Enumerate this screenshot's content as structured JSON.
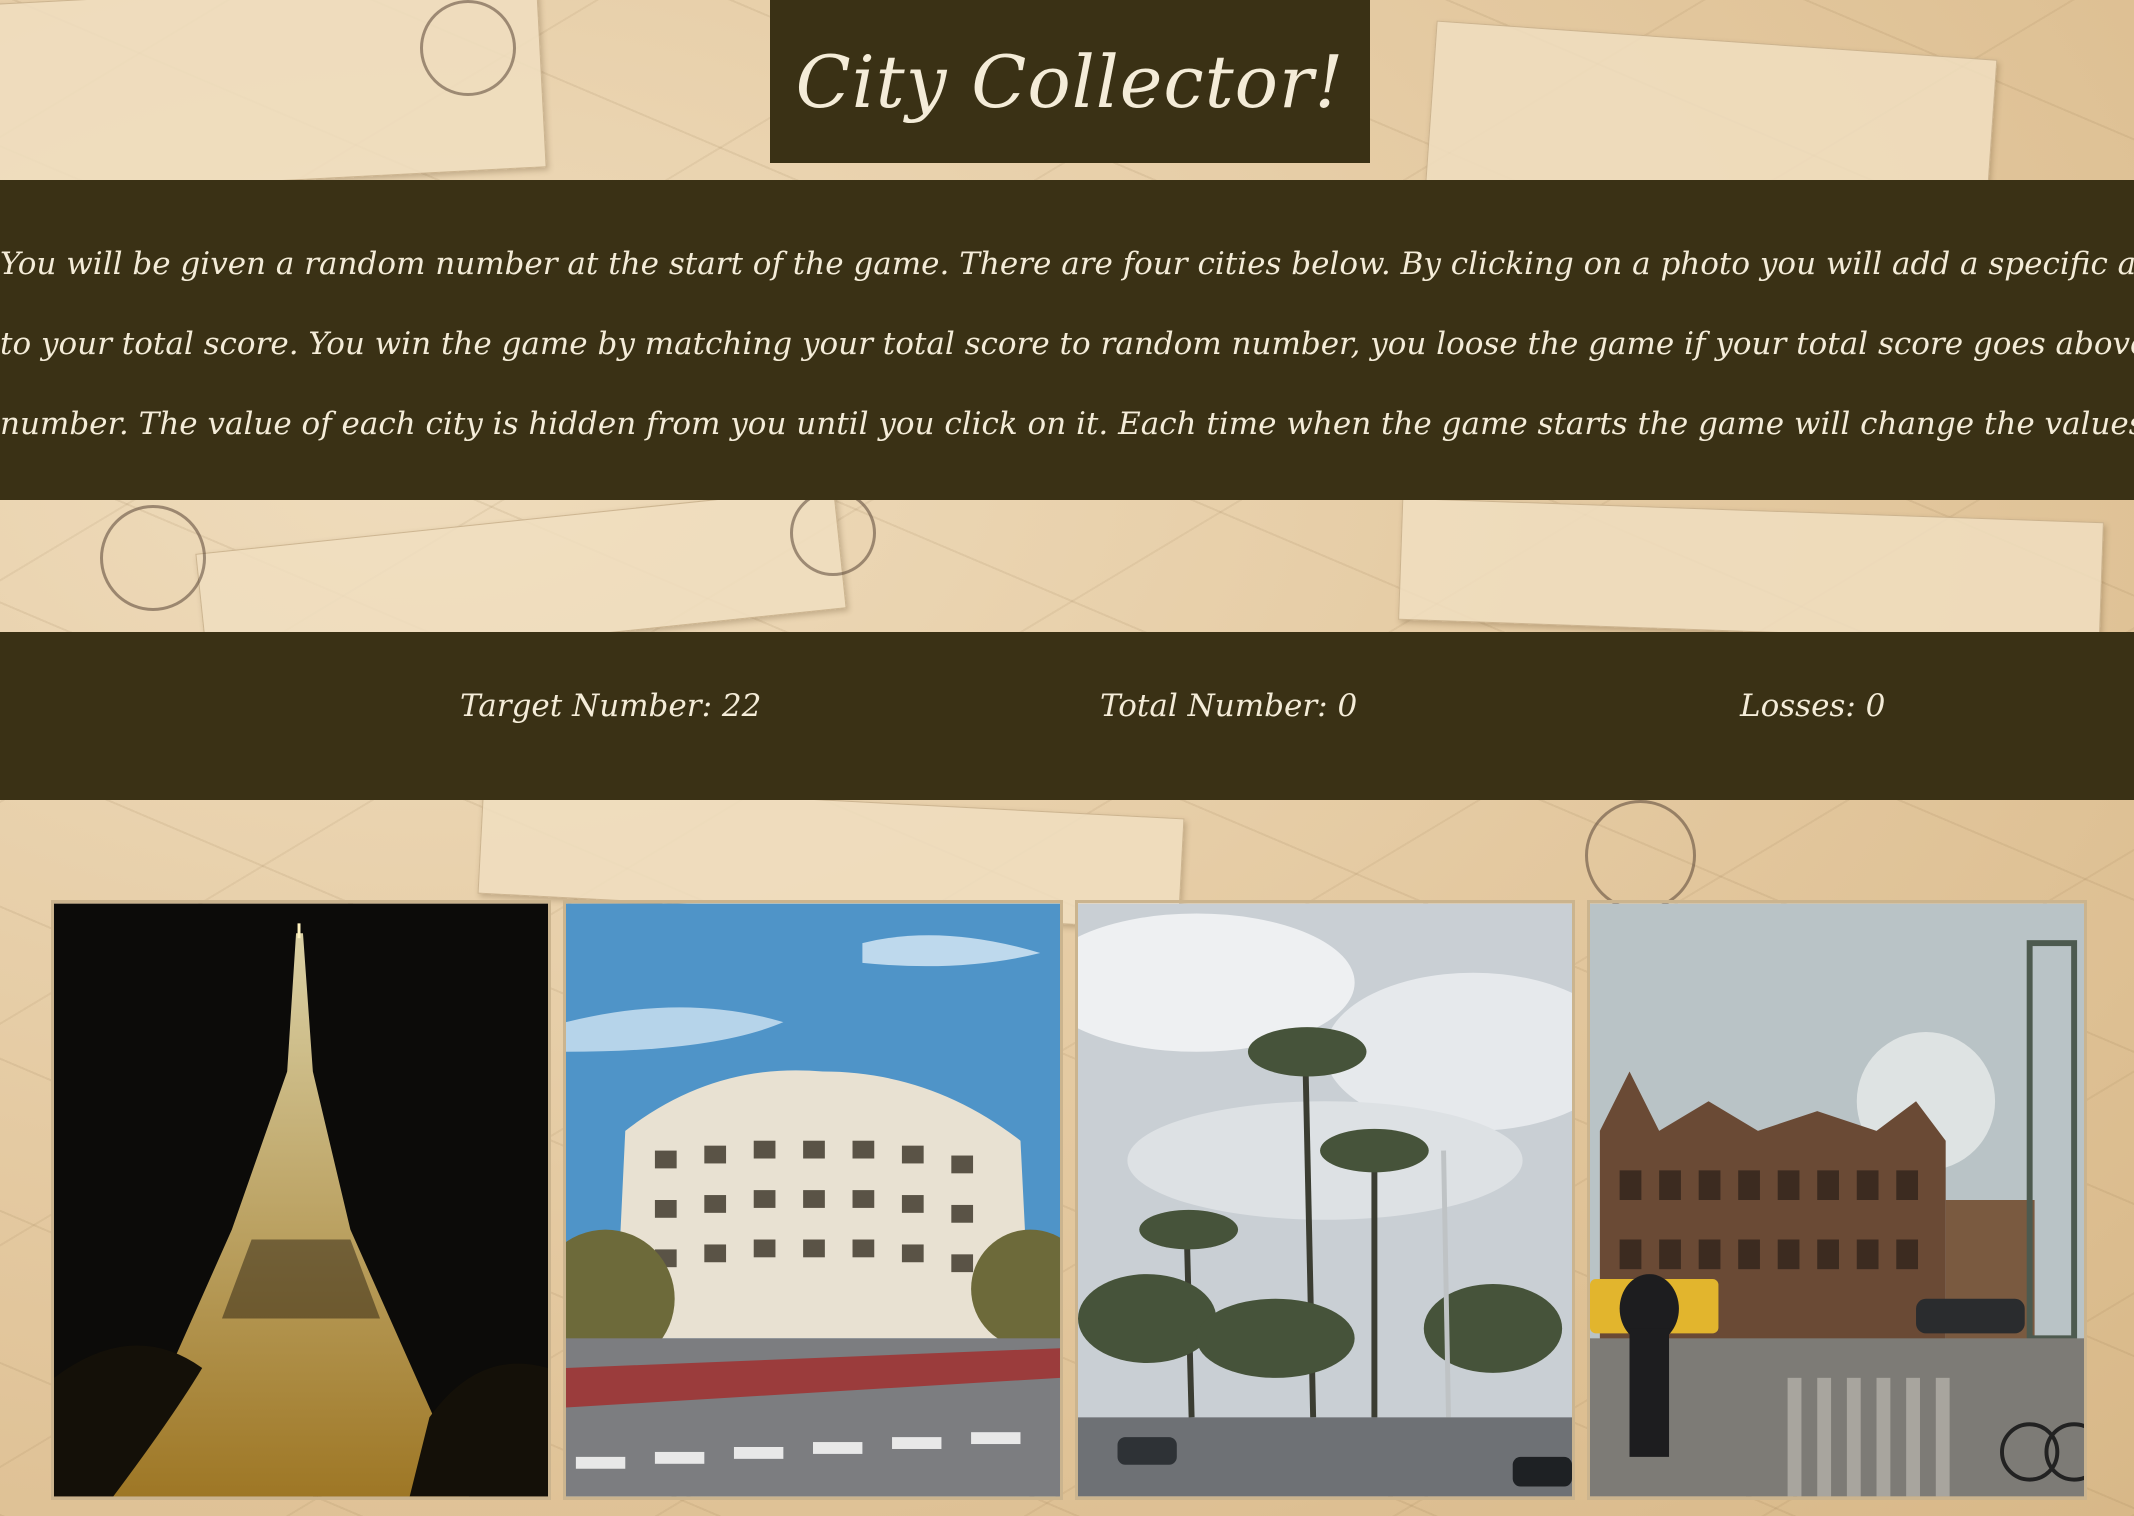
{
  "app": {
    "title": "City Collector!"
  },
  "instructions": {
    "line1": "You will be given a random number at the start of the game. There are four cities below. By clicking on a photo you will add a specific amount of points",
    "line2": "to your total score. You win the game by matching your total score to random number, you loose the game if your total score goes above the randome",
    "line3": "number. The value of each city is hidden from you until you click on it. Each time when the game starts the game will change the values of each city."
  },
  "scoreboard": {
    "target_label": "Target Number: ",
    "target_value": "22",
    "total_label": "Total Number: ",
    "total_value": "0",
    "losses_label": "Losses: ",
    "losses_value": "0"
  },
  "cities": [
    {
      "name": "eiffel-tower-photo"
    },
    {
      "name": "casa-mila-photo"
    },
    {
      "name": "palm-street-photo"
    },
    {
      "name": "tivoli-photo"
    }
  ],
  "colors": {
    "panel": "#3a3115",
    "text": "#f4ecd8",
    "background": "#e6cda6"
  }
}
